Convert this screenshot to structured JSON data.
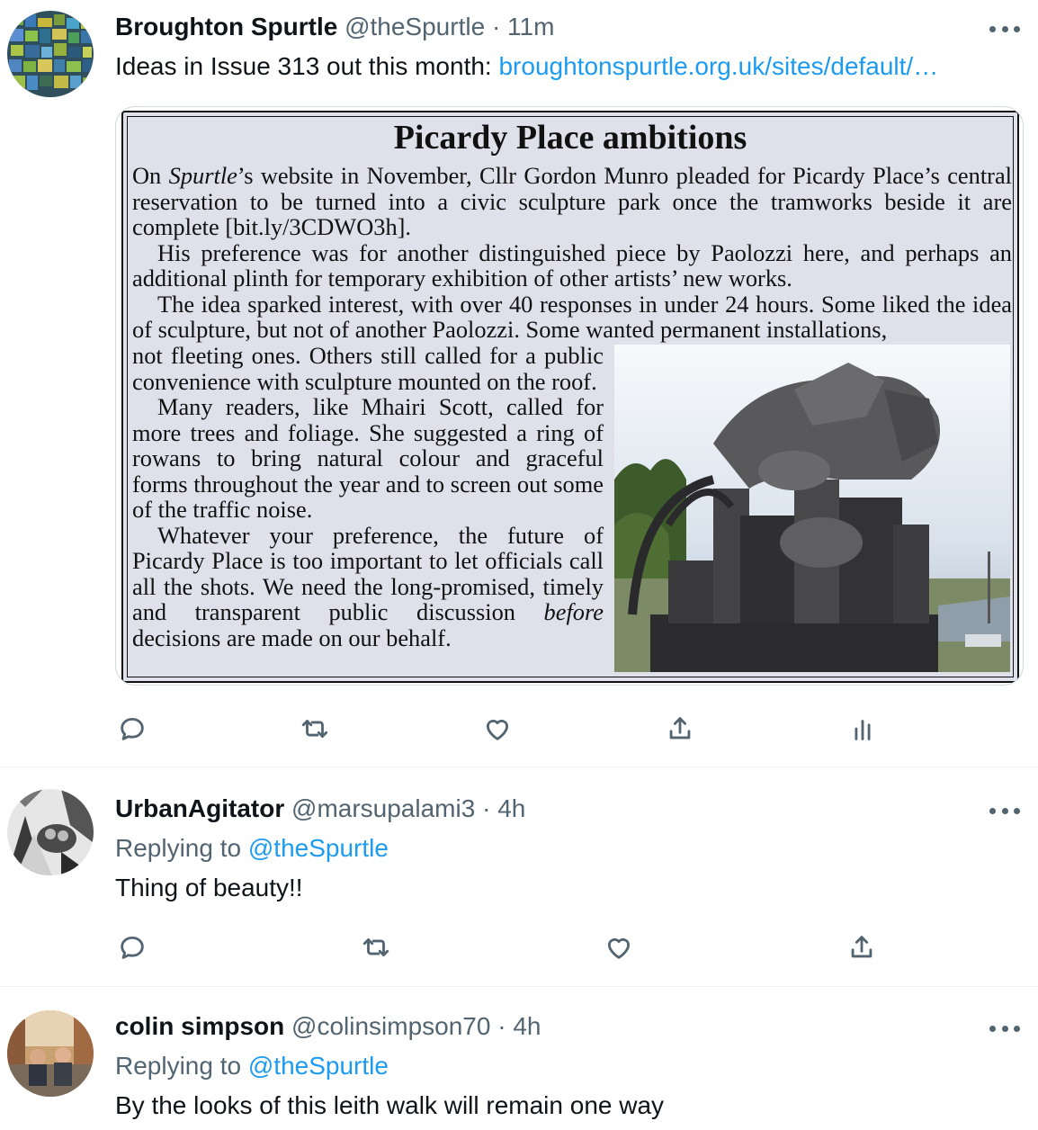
{
  "tweets": [
    {
      "name": "Broughton Spurtle",
      "handle": "@theSpurtle",
      "sep": "·",
      "time": "11m",
      "text": "Ideas in Issue 313 out this month: ",
      "link": "broughtonspurtle.org.uk/sites/default/…"
    },
    {
      "name": "UrbanAgitator",
      "handle": "@marsupalami3",
      "sep": "·",
      "time": "4h",
      "replying_prefix": "Replying to ",
      "replying_to": "@theSpurtle",
      "text": "Thing of beauty!!"
    },
    {
      "name": "colin simpson",
      "handle": "@colinsimpson70",
      "sep": "·",
      "time": "4h",
      "replying_prefix": "Replying to ",
      "replying_to": "@theSpurtle",
      "text": "By the looks of this leith walk will remain one way"
    }
  ],
  "clipping": {
    "title": "Picardy Place ambitions",
    "p1_prefix": "On ",
    "p1_italic": "Spurtle",
    "p1_rest": "’s website in November, Cllr Gordon Munro pleaded for Picardy Place’s central reservation to be turned into a civic sculpture park once the tramworks beside it are complete [bit.ly/3CDWO3h].",
    "p2": "His preference was for another distinguished piece by Paolozzi here, and perhaps an additional plinth for temporary exhibition of other artists’ new works.",
    "p3": "The idea sparked interest, with over 40 responses in under 24 hours. Some liked the idea of sculpture, but not of another Paolozzi. Some wanted permanent installations,",
    "p3_cont": "not fleeting ones. Others still called for a public convenience with sculpture mounted on the roof.",
    "p4": "Many readers, like Mhairi Scott, called for more trees and foliage. She suggested a ring of rowans to bring natural colour and graceful forms throughout the year and to screen out some of the traffic noise.",
    "p5": "Whatever your preference, the future of Picardy Place is too important to let officials call all the shots. We need the long-promised, timely and transparent public discussion ",
    "p5_italic": "before",
    "p5_rest": " decisions are made on our behalf."
  },
  "colors": {
    "text": "#0f1419",
    "secondary": "#536471",
    "link": "#1d9bf0",
    "divider": "#eff3f4"
  },
  "icons": [
    "reply-icon",
    "retweet-icon",
    "like-icon",
    "share-icon",
    "analytics-icon",
    "more-icon"
  ]
}
